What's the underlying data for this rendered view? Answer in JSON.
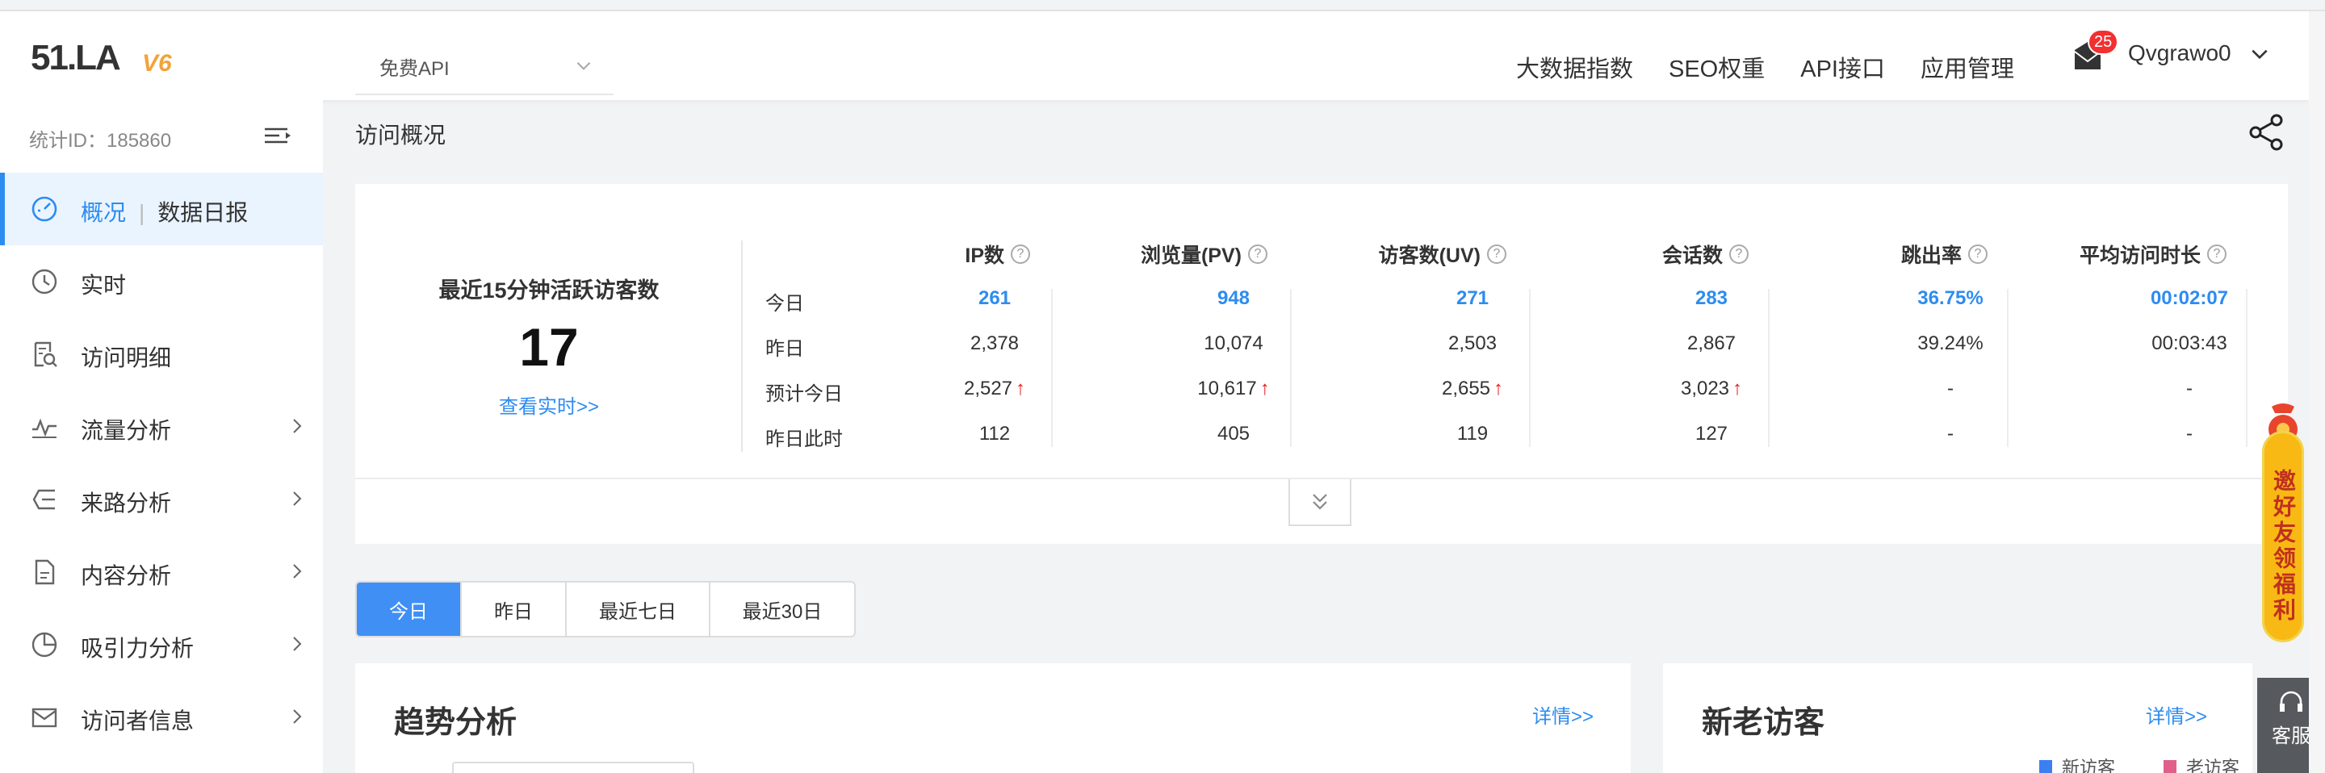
{
  "header": {
    "logo_text": "51.LA",
    "logo_version": "V6",
    "api_select": "免费API",
    "nav": [
      "大数据指数",
      "SEO权重",
      "API接口",
      "应用管理"
    ],
    "message_count": "25",
    "username": "Qvgrawo0"
  },
  "sidebar": {
    "stat_id": "统计ID：185860",
    "items": [
      {
        "label": "概况",
        "sub": "数据日报",
        "icon": "dashboard-icon"
      },
      {
        "label": "实时",
        "icon": "clock-icon"
      },
      {
        "label": "访问明细",
        "icon": "document-search-icon"
      },
      {
        "label": "流量分析",
        "icon": "pulse-icon"
      },
      {
        "label": "来路分析",
        "icon": "source-icon"
      },
      {
        "label": "内容分析",
        "icon": "file-icon"
      },
      {
        "label": "吸引力分析",
        "icon": "pie-icon"
      },
      {
        "label": "访问者信息",
        "icon": "mail-icon"
      }
    ]
  },
  "page": {
    "title": "访问概况"
  },
  "overview": {
    "active_title": "最近15分钟活跃访客数",
    "active_count": "17",
    "active_link": "查看实时>>",
    "columns": [
      "IP数",
      "浏览量(PV)",
      "访客数(UV)",
      "会话数",
      "跳出率",
      "平均访问时长"
    ],
    "rows": [
      {
        "label": "今日",
        "values": [
          "261",
          "948",
          "271",
          "283",
          "36.75%",
          "00:02:07"
        ],
        "up": [
          false,
          false,
          false,
          false,
          false,
          false
        ]
      },
      {
        "label": "昨日",
        "values": [
          "2,378",
          "10,074",
          "2,503",
          "2,867",
          "39.24%",
          "00:03:43"
        ],
        "up": [
          false,
          false,
          false,
          false,
          false,
          false
        ]
      },
      {
        "label": "预计今日",
        "values": [
          "2,527",
          "10,617",
          "2,655",
          "3,023",
          "-",
          "-"
        ],
        "up": [
          true,
          true,
          true,
          true,
          false,
          false
        ]
      },
      {
        "label": "昨日此时",
        "values": [
          "112",
          "405",
          "119",
          "127",
          "-",
          "-"
        ],
        "up": [
          false,
          false,
          false,
          false,
          false,
          false
        ]
      }
    ],
    "help_glyph": "?",
    "up_arrow": "↑"
  },
  "tabs": [
    "今日",
    "昨日",
    "最近七日",
    "最近30日"
  ],
  "trend": {
    "title": "趋势分析",
    "detail": "详情>>"
  },
  "visitors": {
    "title": "新老访客",
    "detail": "详情>>",
    "legend": [
      {
        "name": "新访客",
        "color": "#3b7ff0"
      },
      {
        "name": "老访客",
        "color": "#e0608a"
      }
    ]
  },
  "float": {
    "invite": "邀好友领福利",
    "service": "客服"
  },
  "colors": {
    "accent": "#2d8cf0",
    "up": "#e02020"
  }
}
